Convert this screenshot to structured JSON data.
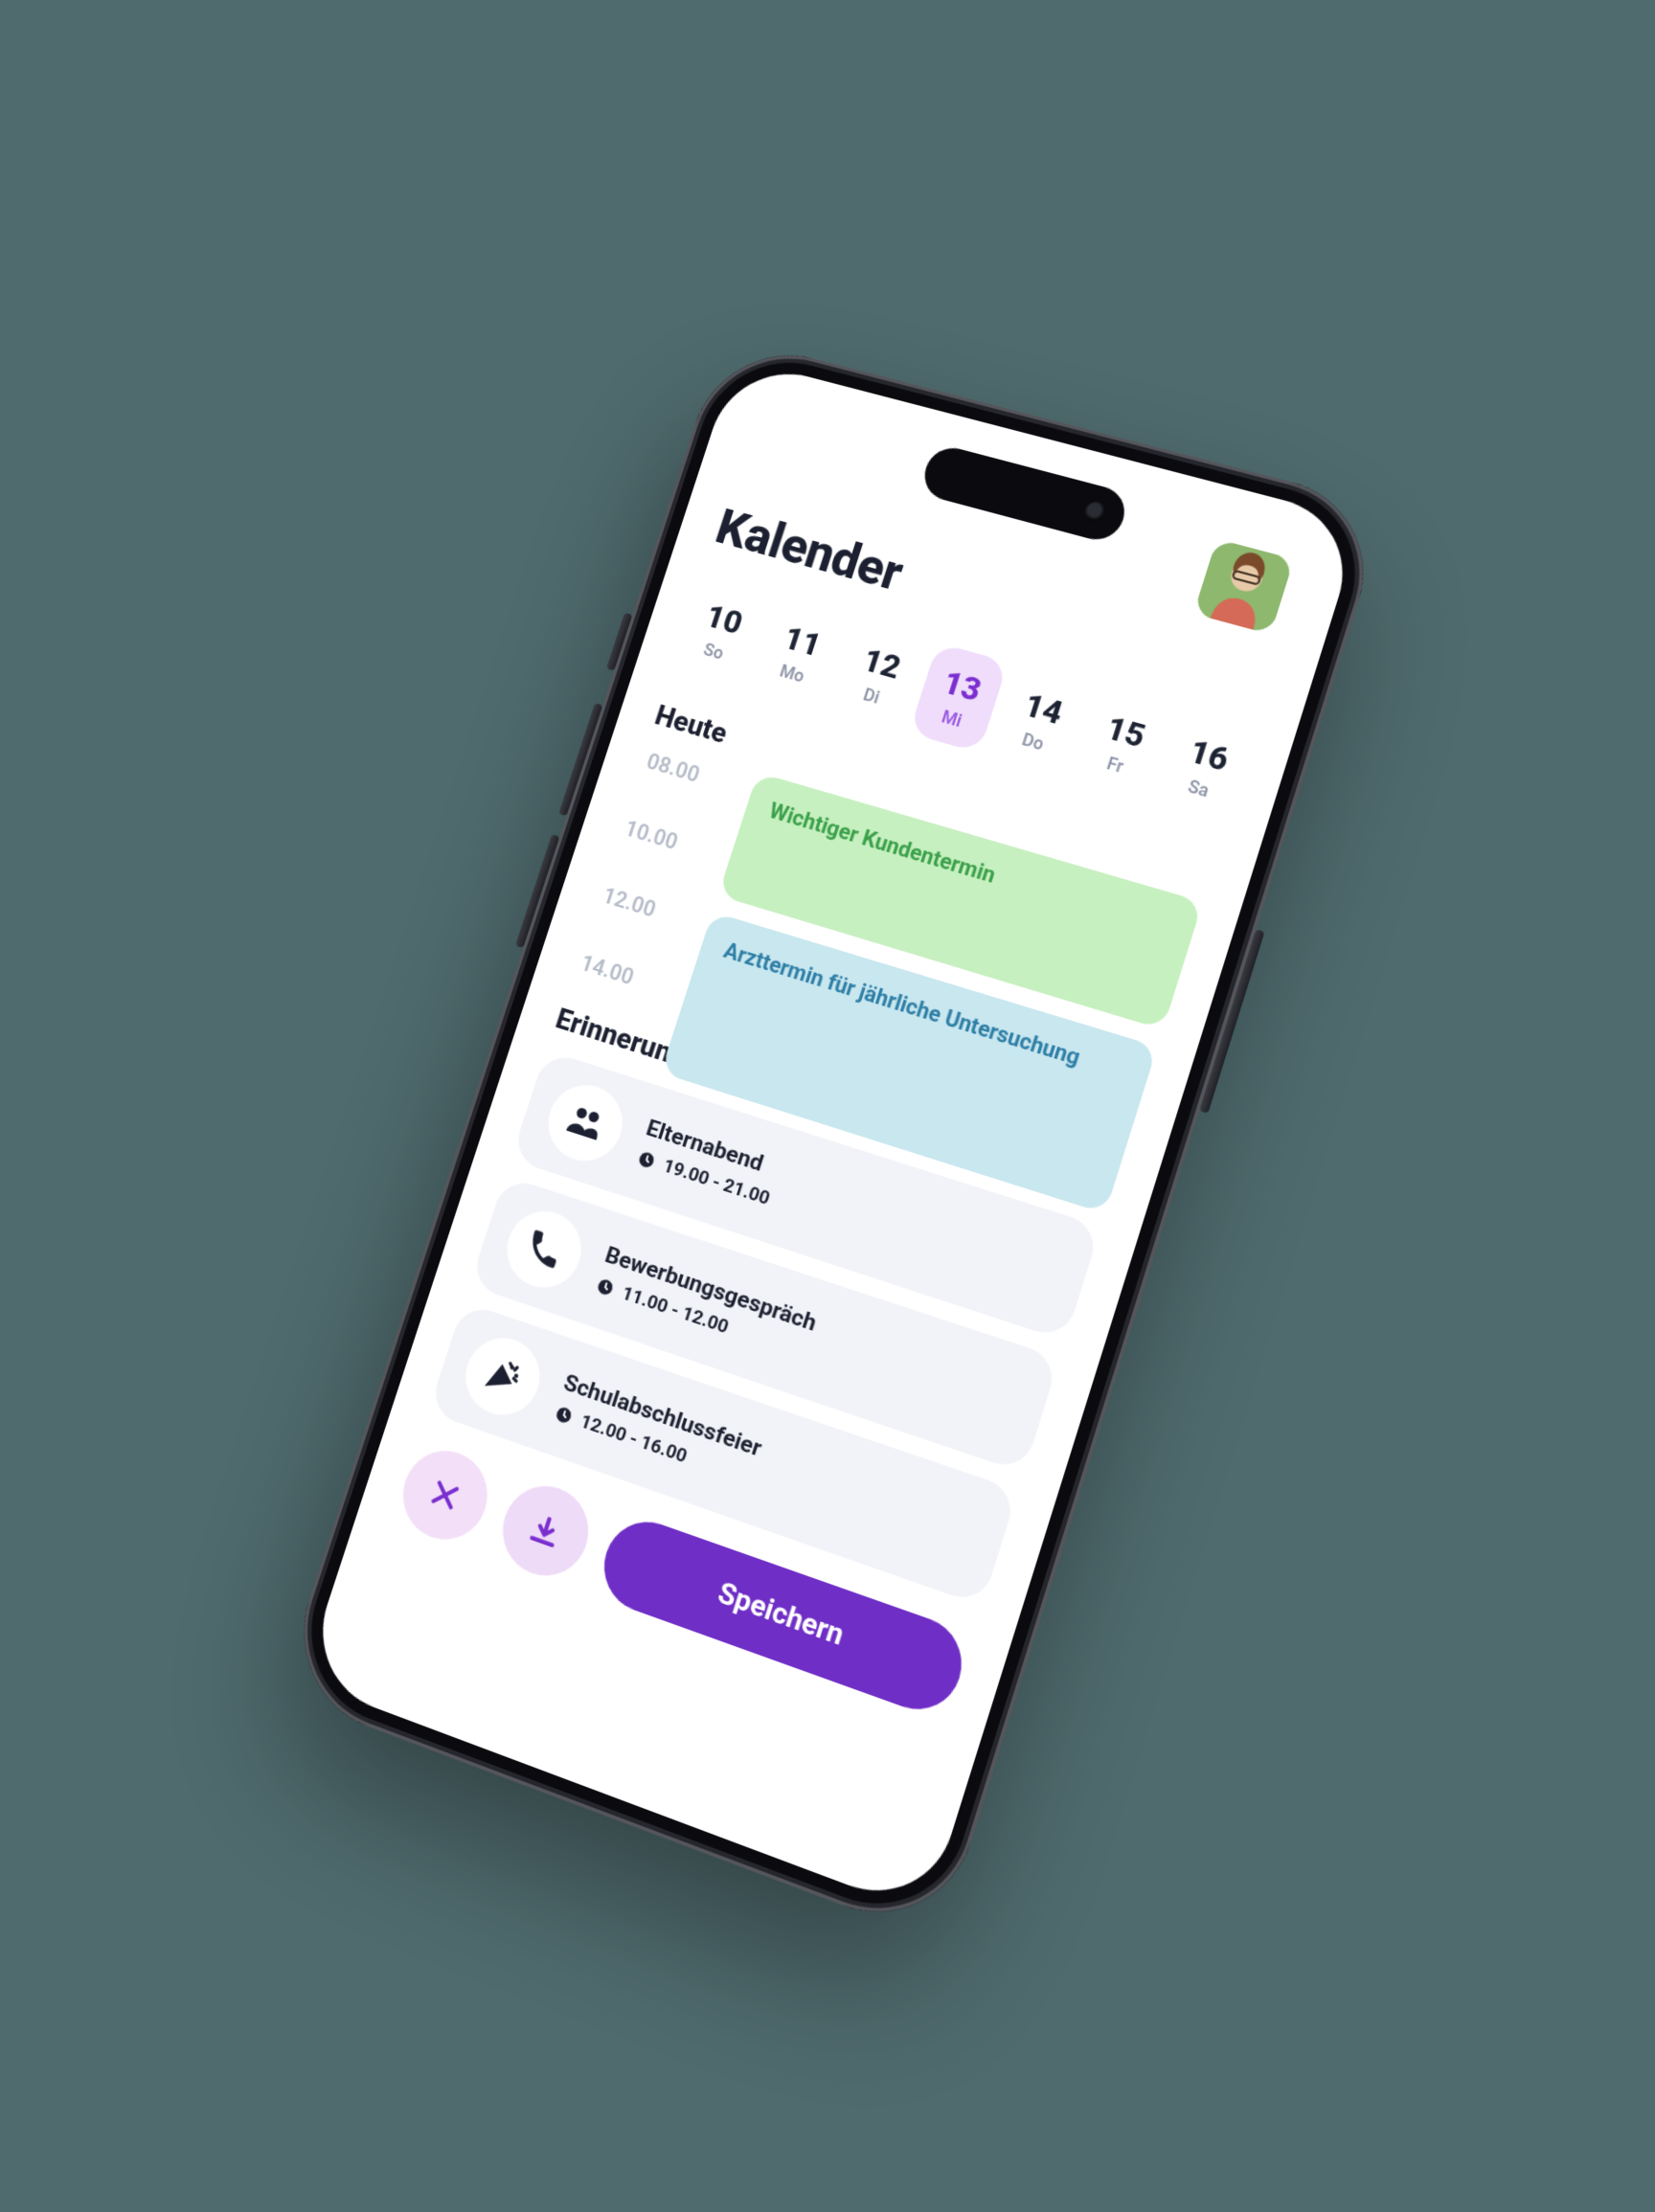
{
  "header": {
    "title": "Kalender"
  },
  "week": [
    {
      "num": "10",
      "abbr": "So",
      "selected": false
    },
    {
      "num": "11",
      "abbr": "Mo",
      "selected": false
    },
    {
      "num": "12",
      "abbr": "Di",
      "selected": false
    },
    {
      "num": "13",
      "abbr": "Mi",
      "selected": true
    },
    {
      "num": "14",
      "abbr": "Do",
      "selected": false
    },
    {
      "num": "15",
      "abbr": "Fr",
      "selected": false
    },
    {
      "num": "16",
      "abbr": "Sa",
      "selected": false
    }
  ],
  "today_label": "Heute",
  "timeline": {
    "times": [
      "08.00",
      "10.00",
      "12.00",
      "14.00"
    ],
    "events": [
      {
        "title": "Wichtiger Kundentermin",
        "class": "e1"
      },
      {
        "title": "Arzttermin für jährliche Untersuchung",
        "class": "e2"
      }
    ]
  },
  "reminders_label": "Erinnerungen",
  "reminders": [
    {
      "icon": "people-icon",
      "title": "Elternabend",
      "time": "19.00 - 21.00"
    },
    {
      "icon": "phone-icon",
      "title": "Bewerbungsgespräch",
      "time": "11.00 - 12.00"
    },
    {
      "icon": "party-icon",
      "title": "Schulabschlussfeier",
      "time": "12.00 - 16.00"
    }
  ],
  "actions": {
    "close_label": "close",
    "download_label": "download",
    "save_label": "Speichern"
  },
  "colors": {
    "accent": "#6f2ec6",
    "accent_soft": "#efddfb",
    "event_green_bg": "#c6f0bf",
    "event_green_fg": "#3aa04a",
    "event_blue_bg": "#c8e7ef",
    "event_blue_fg": "#2e7ea6"
  }
}
